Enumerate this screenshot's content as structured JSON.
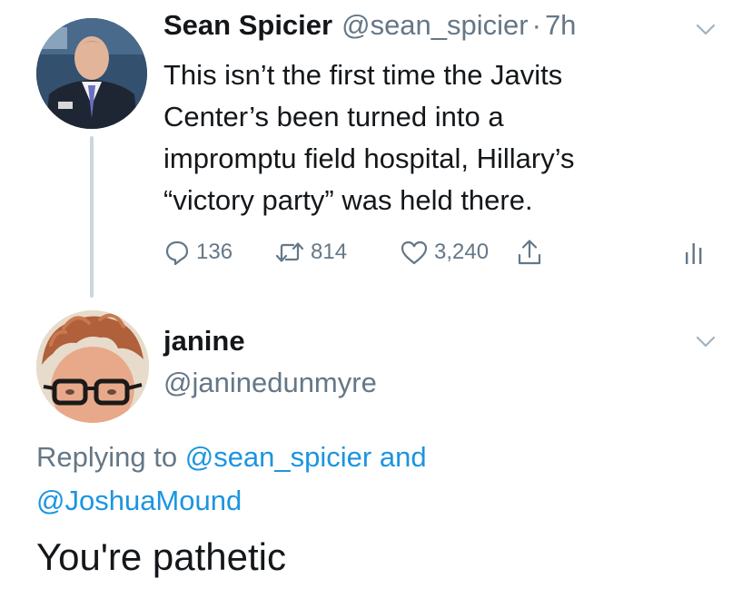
{
  "parent_tweet": {
    "display_name": "Sean Spicier",
    "handle": "@sean_spicier",
    "separator": "·",
    "time": "7h",
    "text_lines": [
      "This isn’t the first time the Javits",
      "Center’s been turned into a",
      "impromptu field hospital, Hillary’s",
      "“victory party” was held there."
    ],
    "actions": {
      "reply_icon": "reply-bubble-icon",
      "reply_count": "136",
      "retweet_icon": "retweet-icon",
      "retweet_count": "814",
      "like_icon": "heart-icon",
      "like_count": "3,240",
      "share_icon": "share-icon",
      "analytics_icon": "analytics-icon"
    },
    "menu_icon": "chevron-down-icon"
  },
  "reply_tweet": {
    "display_name": "janine",
    "handle": "@janinedunmyre",
    "replying_prefix": "Replying to",
    "mention_1": "@sean_spicier",
    "conjunction": "and",
    "mention_2": "@JoshuaMound",
    "text": "You're pathetic",
    "menu_icon": "chevron-down-icon"
  },
  "colors": {
    "text_primary": "#14171a",
    "text_secondary": "#657786",
    "link": "#1b95e0",
    "thread_line": "#ccd6dd"
  }
}
